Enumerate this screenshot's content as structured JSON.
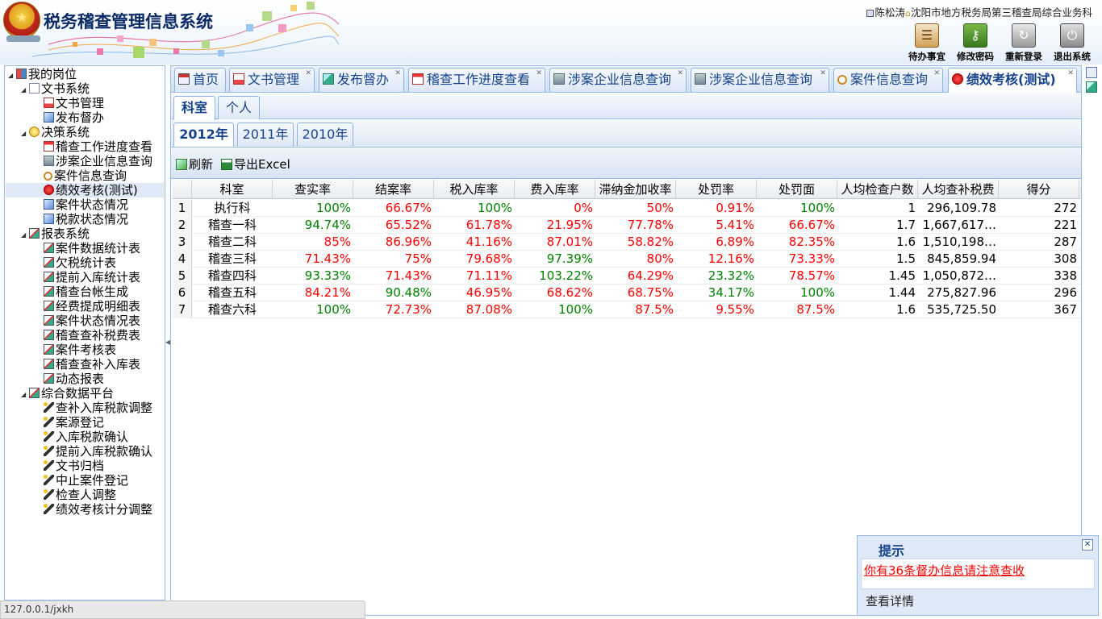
{
  "header": {
    "app_title": "税务稽查管理信息系统",
    "user_name": "陈松涛",
    "user_dept": "沈阳市地方税务局第三稽查局综合业务科",
    "buttons": {
      "todo": "待办事宜",
      "change_password": "修改密码",
      "relogin": "重新登录",
      "exit": "退出系统"
    }
  },
  "sidebar": {
    "root": "我的岗位",
    "groups": [
      {
        "label": "文书系统",
        "items": [
          "文书管理",
          "发布督办"
        ]
      },
      {
        "label": "决策系统",
        "items": [
          "稽查工作进度查看",
          "涉案企业信息查询",
          "案件信息查询",
          "绩效考核(测试)",
          "案件状态情况",
          "税款状态情况"
        ]
      },
      {
        "label": "报表系统",
        "items": [
          "案件数据统计表",
          "欠税统计表",
          "提前入库统计表",
          "稽查台帐生成",
          "经费提成明细表",
          "案件状态情况表",
          "稽查查补税费表",
          "案件考核表",
          "稽查查补入库表",
          "动态报表"
        ]
      },
      {
        "label": "综合数据平台",
        "items": [
          "查补入库税款调整",
          "案源登记",
          "入库税款确认",
          "提前入库税款确认",
          "文书归档",
          "中止案件登记",
          "检查人调整",
          "绩效考核计分调整"
        ]
      }
    ],
    "selected": "绩效考核(测试)"
  },
  "tabs": [
    "首页",
    "文书管理",
    "发布督办",
    "稽查工作进度查看",
    "涉案企业信息查询",
    "涉案企业信息查询",
    "案件信息查询",
    "绩效考核(测试)"
  ],
  "active_tab": "绩效考核(测试)",
  "subtabs": [
    "科室",
    "个人"
  ],
  "year_tabs": [
    "2012年",
    "2011年",
    "2010年"
  ],
  "toolbar": {
    "refresh": "刷新",
    "export": "导出Excel"
  },
  "grid": {
    "columns": [
      "科室",
      "查实率",
      "结案率",
      "税入库率",
      "费入库率",
      "滞纳金加收率",
      "处罚率",
      "处罚面",
      "人均检查户数",
      "人均查补税费",
      "得分"
    ],
    "rows": [
      {
        "n": "1",
        "科室": "执行科",
        "查实率": "100%",
        "结案率": "66.67%",
        "税入库率": "100%",
        "费入库率": "0%",
        "滞纳金加收率": "50%",
        "处罚率": "0.91%",
        "处罚面": "100%",
        "人均检查户数": "1",
        "人均查补税费": "296,109.78",
        "得分": "272"
      },
      {
        "n": "2",
        "科室": "稽查一科",
        "查实率": "94.74%",
        "结案率": "65.52%",
        "税入库率": "61.78%",
        "费入库率": "21.95%",
        "滞纳金加收率": "77.78%",
        "处罚率": "5.41%",
        "处罚面": "66.67%",
        "人均检查户数": "1.7",
        "人均查补税费": "1,667,617…",
        "得分": "221"
      },
      {
        "n": "3",
        "科室": "稽查二科",
        "查实率": "85%",
        "结案率": "86.96%",
        "税入库率": "41.16%",
        "费入库率": "87.01%",
        "滞纳金加收率": "58.82%",
        "处罚率": "6.89%",
        "处罚面": "82.35%",
        "人均检查户数": "1.6",
        "人均查补税费": "1,510,198…",
        "得分": "287"
      },
      {
        "n": "4",
        "科室": "稽查三科",
        "查实率": "71.43%",
        "结案率": "75%",
        "税入库率": "79.68%",
        "费入库率": "97.39%",
        "滞纳金加收率": "80%",
        "处罚率": "12.16%",
        "处罚面": "73.33%",
        "人均检查户数": "1.5",
        "人均查补税费": "845,859.94",
        "得分": "308"
      },
      {
        "n": "5",
        "科室": "稽查四科",
        "查实率": "93.33%",
        "结案率": "71.43%",
        "税入库率": "71.11%",
        "费入库率": "103.22%",
        "滞纳金加收率": "64.29%",
        "处罚率": "23.32%",
        "处罚面": "78.57%",
        "人均检查户数": "1.45",
        "人均查补税费": "1,050,872…",
        "得分": "338"
      },
      {
        "n": "6",
        "科室": "稽查五科",
        "查实率": "84.21%",
        "结案率": "90.48%",
        "税入库率": "46.95%",
        "费入库率": "68.62%",
        "滞纳金加收率": "68.75%",
        "处罚率": "34.17%",
        "处罚面": "100%",
        "人均检查户数": "1.44",
        "人均查补税费": "275,827.96",
        "得分": "296"
      },
      {
        "n": "7",
        "科室": "稽查六科",
        "查实率": "100%",
        "结案率": "72.73%",
        "税入库率": "87.08%",
        "费入库率": "100%",
        "滞纳金加收率": "87.5%",
        "处罚率": "9.55%",
        "处罚面": "87.5%",
        "人均检查户数": "1.6",
        "人均查补税费": "535,725.50",
        "得分": "367"
      }
    ],
    "colors": {
      "查实率": [
        "green",
        "green",
        "red",
        "red",
        "green",
        "red",
        "green"
      ],
      "结案率": [
        "red",
        "red",
        "red",
        "red",
        "red",
        "green",
        "red"
      ],
      "税入库率": [
        "green",
        "red",
        "red",
        "red",
        "red",
        "red",
        "red"
      ],
      "费入库率": [
        "red",
        "red",
        "red",
        "green",
        "green",
        "red",
        "green"
      ],
      "滞纳金加收率": [
        "red",
        "red",
        "red",
        "red",
        "red",
        "red",
        "red"
      ],
      "处罚率": [
        "red",
        "red",
        "red",
        "red",
        "green",
        "green",
        "red"
      ],
      "处罚面": [
        "green",
        "red",
        "red",
        "red",
        "red",
        "green",
        "red"
      ]
    }
  },
  "notice": {
    "title": "提示",
    "message": "你有36条督办信息请注意查收",
    "detail": "查看详情"
  },
  "statusbar": "127.0.0.1/jxkh",
  "palette": {
    "green": "#008000",
    "red": "#ff0000",
    "border": "#99bbe8",
    "tab_text": "#15428b"
  }
}
